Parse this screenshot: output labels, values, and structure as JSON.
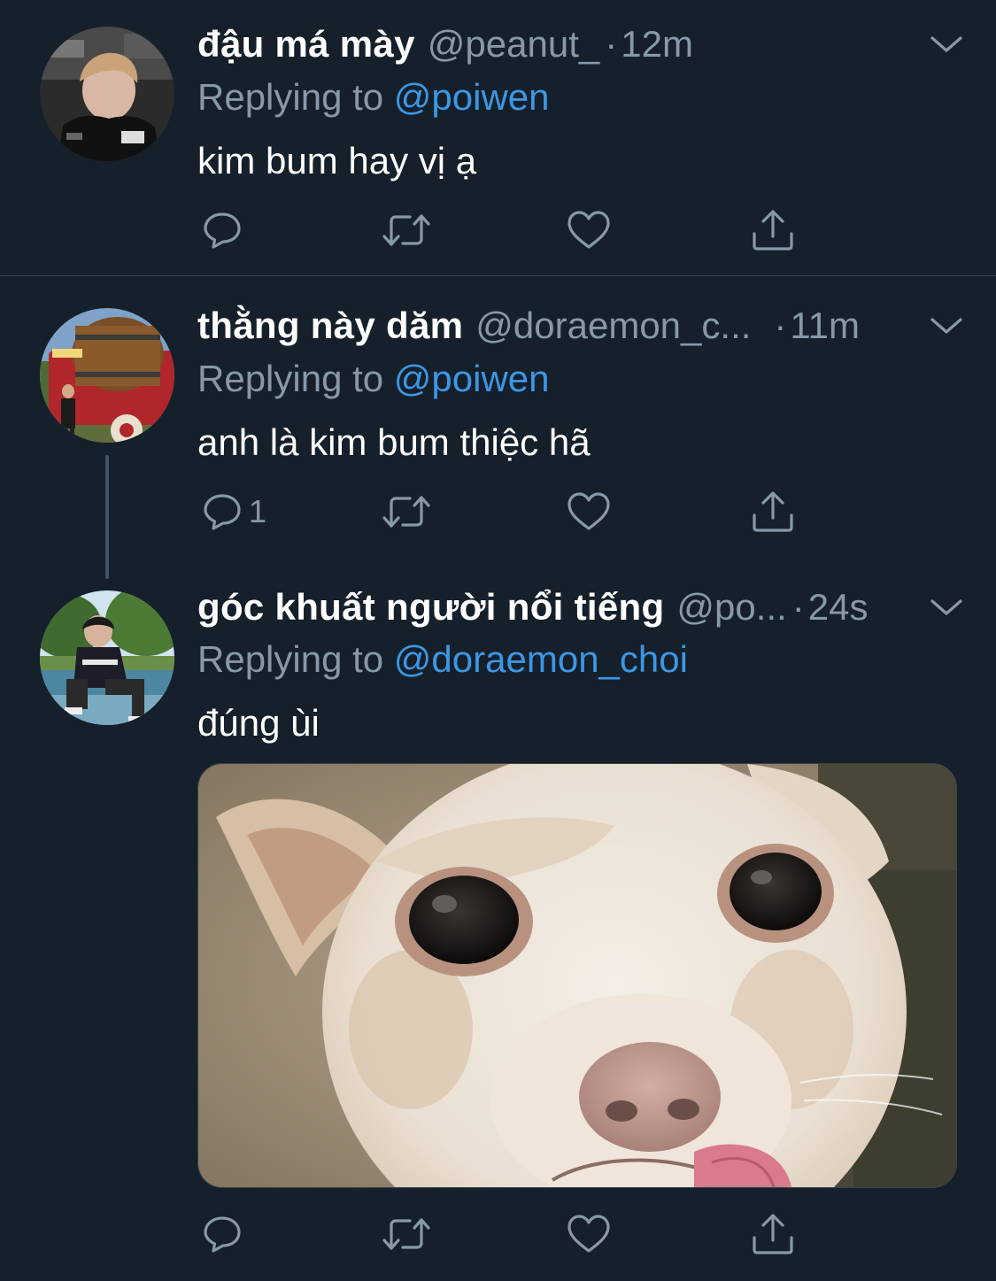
{
  "tweets": [
    {
      "display_name": "đậu má mày",
      "handle": "@peanut_",
      "separator": "·",
      "time": "12m",
      "replying_prefix": "Replying to",
      "replying_to": "@poiwen",
      "text": "kim bum hay vị ạ",
      "reply_count": ""
    },
    {
      "display_name": "thằng này dăm",
      "handle": "@doraemon_c...",
      "separator": "·",
      "time": "11m",
      "replying_prefix": "Replying to",
      "replying_to": "@poiwen",
      "text": "anh là kim bum thiệc hã",
      "reply_count": "1"
    },
    {
      "display_name": "góc khuất người nổi tiếng",
      "handle": "@po...",
      "separator": "·",
      "time": "24s",
      "replying_prefix": "Replying to",
      "replying_to": "@doraemon_choi",
      "text": "đúng ùi",
      "reply_count": ""
    }
  ],
  "icons": {
    "more": "chevron-down-icon",
    "reply": "reply-bubble-icon",
    "retweet": "retweet-icon",
    "like": "heart-icon",
    "share": "share-icon"
  },
  "colors": {
    "background": "#15202b",
    "secondary_text": "#8899a6",
    "mention": "#3c97e5",
    "divider": "#38444d",
    "thread_line": "#3d5466"
  }
}
